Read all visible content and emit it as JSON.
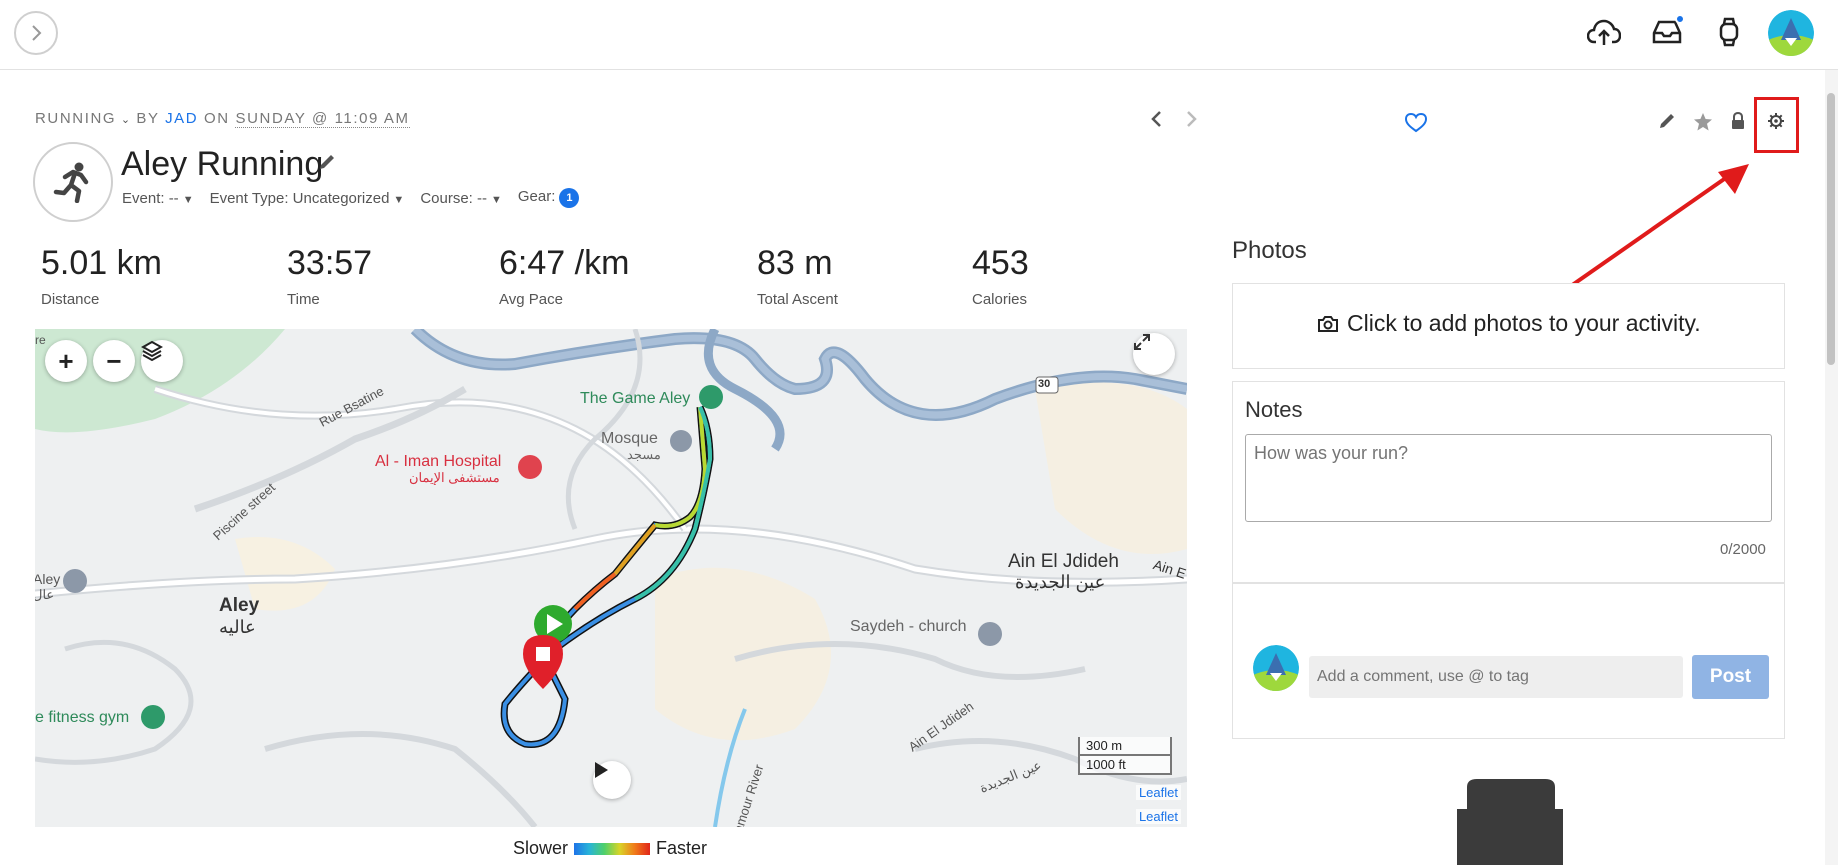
{
  "header": {
    "upload_icon": "cloud-upload-icon",
    "inbox_icon": "inbox-icon",
    "watch_icon": "watch-icon",
    "accent": "#1a73e8"
  },
  "activity": {
    "type_label": "RUNNING",
    "by_label": "BY",
    "author": "JAD",
    "on_label": "ON",
    "datetime": "SUNDAY @ 11:09 AM",
    "title": "Aley Running",
    "event_label": "Event: --",
    "event_type_label": "Event Type: Uncategorized",
    "course_label": "Course: --",
    "gear_label": "Gear:",
    "gear_count": "1"
  },
  "stats": [
    {
      "value": "5.01 km",
      "label": "Distance"
    },
    {
      "value": "33:57",
      "label": "Time"
    },
    {
      "value": "6:47 /km",
      "label": "Avg Pace"
    },
    {
      "value": "83 m",
      "label": "Total Ascent"
    },
    {
      "value": "453",
      "label": "Calories"
    }
  ],
  "map": {
    "zoom_in": "+",
    "zoom_out": "−",
    "labels": {
      "game": "The Game Aley",
      "mosque": "Mosque",
      "mosque_ar": "مسجد",
      "hospital": "Al - Iman Hospital",
      "hospital_ar": "مستشفى الإيمان",
      "rue_bsatine": "Rue Bsatine",
      "piscine": "Piscine street",
      "aley": "Aley",
      "aley_ar": "عاليه",
      "aley_left": "Aley",
      "aley_left_ar": "عال",
      "fitness": "e fitness gym",
      "jdideh": "Ain El Jdideh",
      "jdideh_ar": "عين الجديدة",
      "ain_e": "Ain E",
      "saydeh": "Saydeh - church",
      "ain_jdideh_road": "Ain El Jdideh",
      "ain_jdideh_road_ar": "عين الجديدة",
      "river": "amour River",
      "road30": "30",
      "re": "re"
    },
    "scale_metric": "300 m",
    "scale_imperial": "1000 ft",
    "attribution": "Leaflet"
  },
  "legend": {
    "slower": "Slower",
    "faster": "Faster"
  },
  "photos": {
    "title": "Photos",
    "cta": "Click to add photos to your activity."
  },
  "notes": {
    "title": "Notes",
    "placeholder": "How was your run?",
    "counter": "0/2000"
  },
  "comment": {
    "placeholder": "Add a comment, use @ to tag",
    "post_label": "Post"
  }
}
